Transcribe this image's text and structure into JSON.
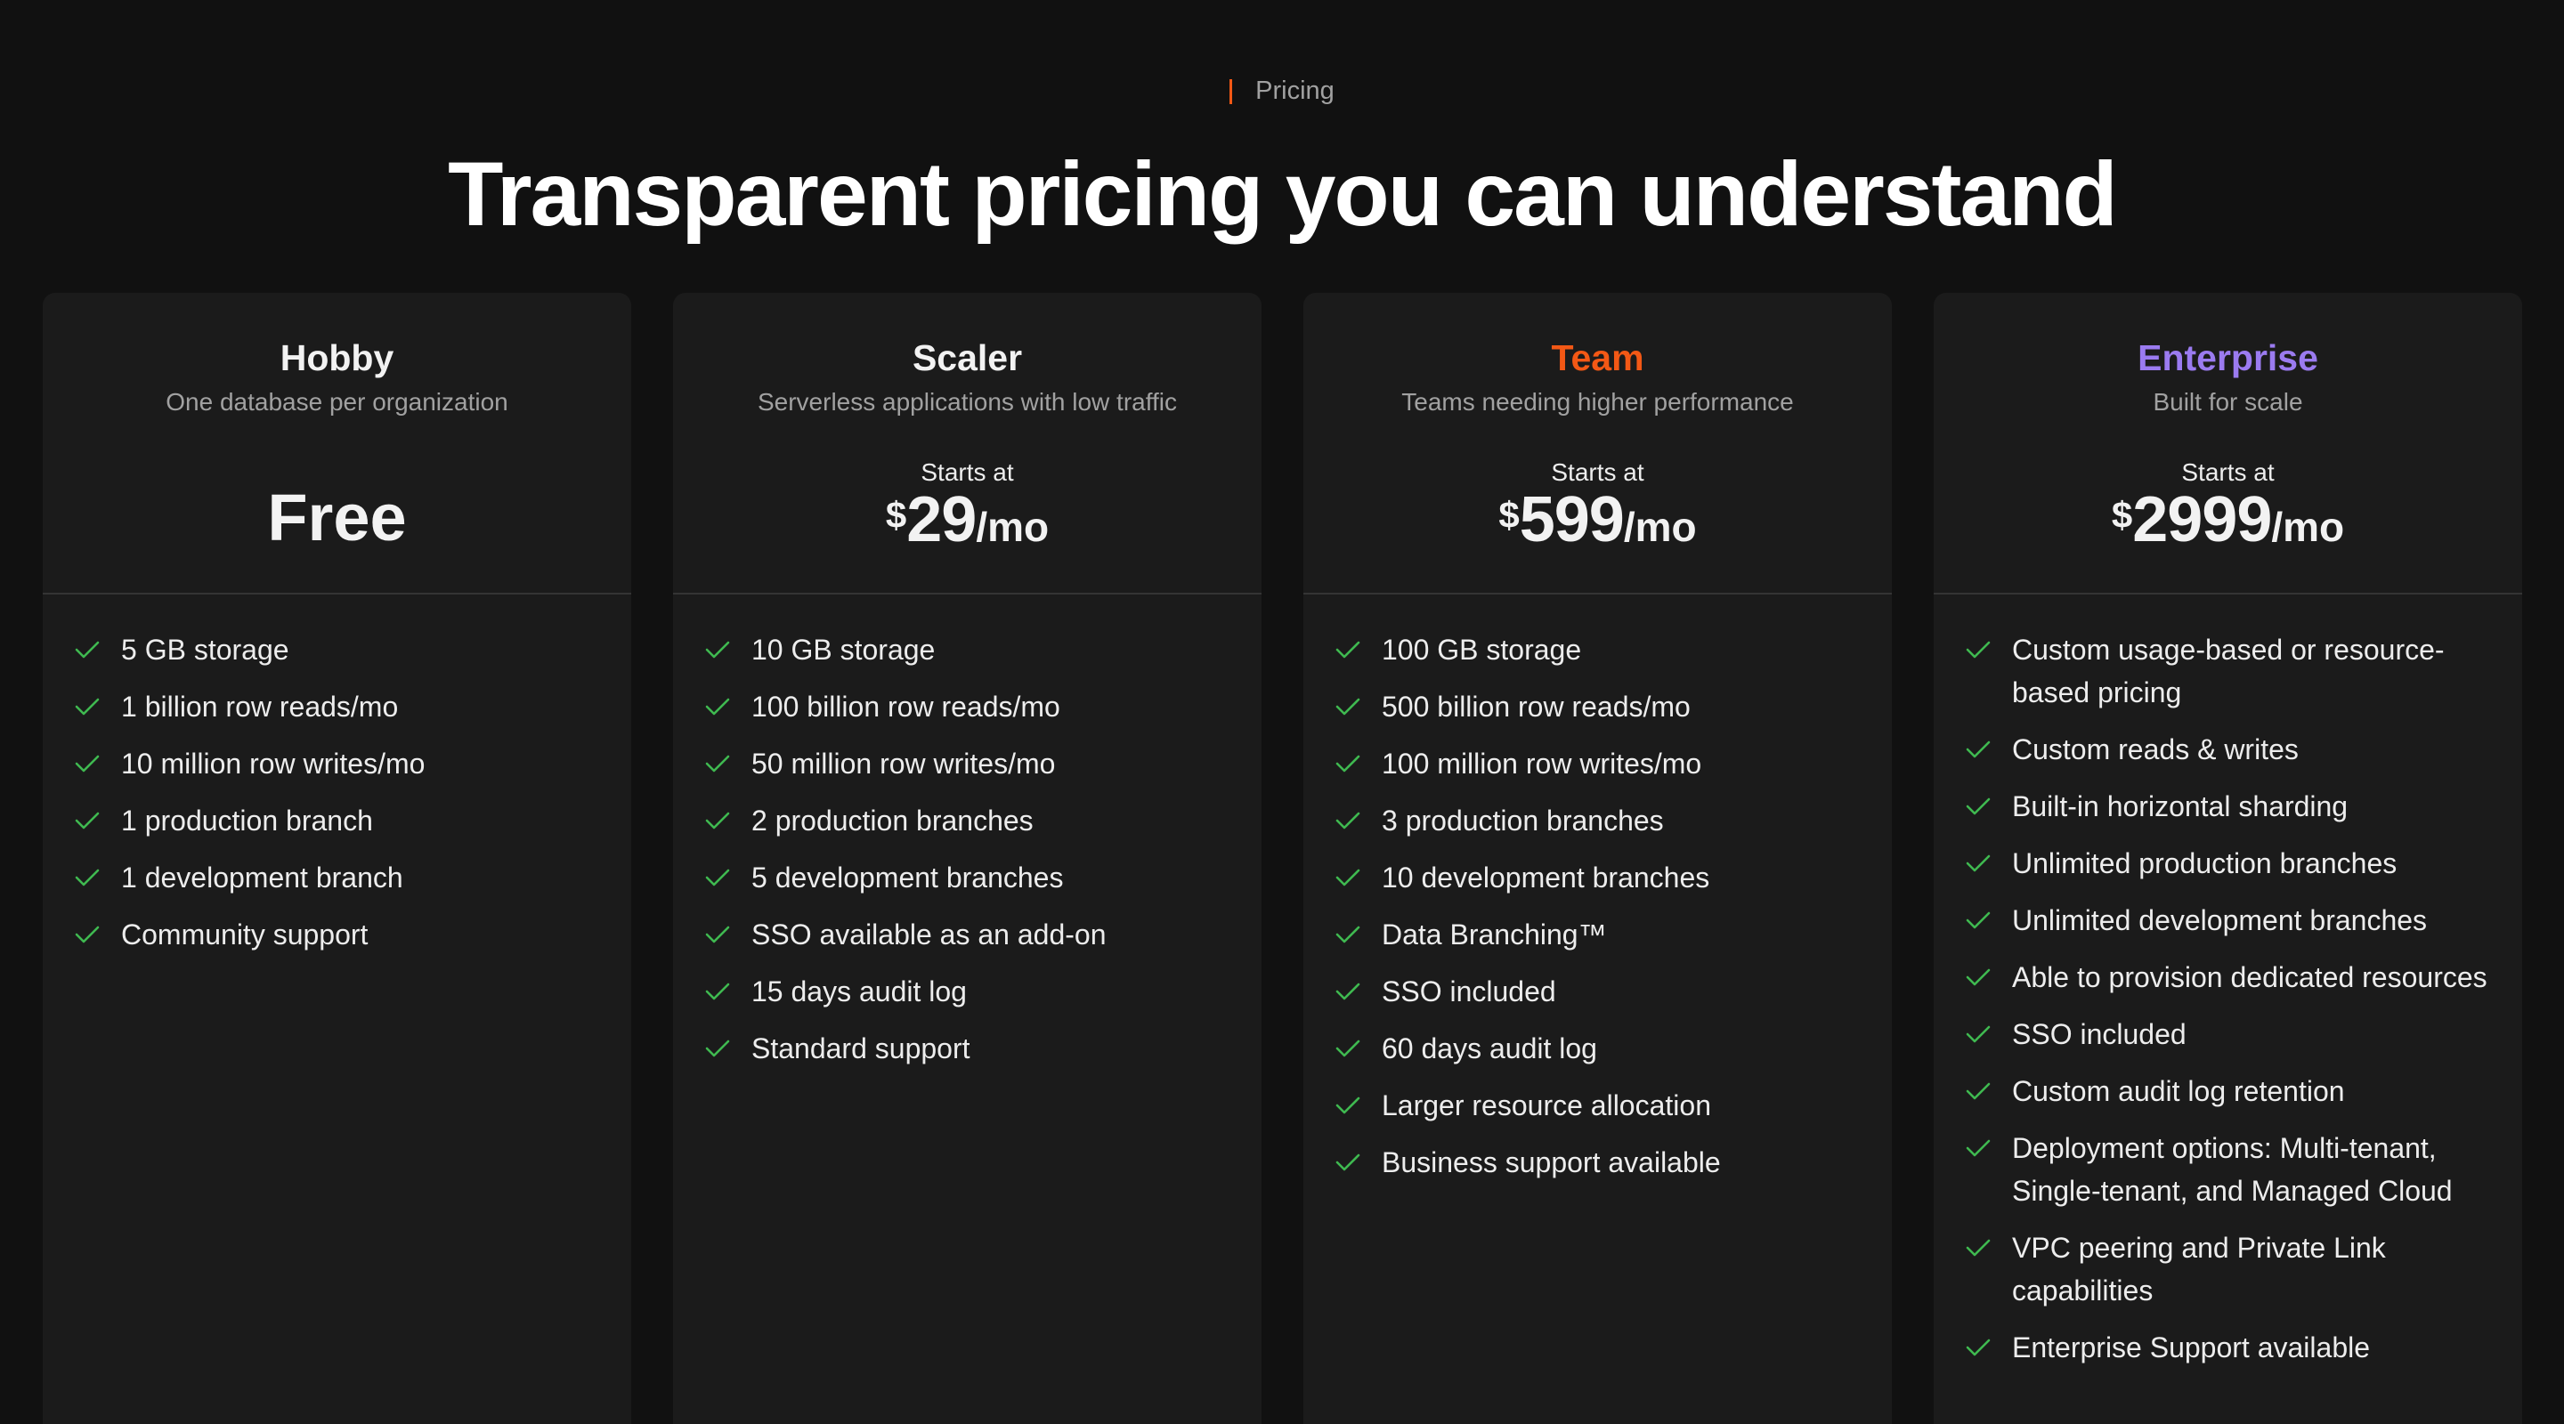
{
  "eyebrow": "Pricing",
  "headline": "Transparent pricing you can understand",
  "colors": {
    "background": "#111111",
    "card": "#1b1b1b",
    "accent_orange": "#f35815",
    "accent_purple": "#9b7bf0",
    "check_green": "#3fb950"
  },
  "plans": [
    {
      "name": "Hobby",
      "name_color": "#f2f2f2",
      "description": "One database per organization",
      "price_label": "Free",
      "features": [
        "5 GB storage",
        "1 billion row reads/mo",
        "10 million row writes/mo",
        "1 production branch",
        "1 development branch",
        "Community support"
      ]
    },
    {
      "name": "Scaler",
      "name_color": "#f2f2f2",
      "description": "Serverless applications with low traffic",
      "starts_at": "Starts at",
      "currency": "$",
      "amount": "29",
      "period": "/mo",
      "features": [
        "10 GB storage",
        "100 billion row reads/mo",
        "50 million row writes/mo",
        "2 production branches",
        "5 development branches",
        "SSO available as an add-on",
        "15 days audit log",
        "Standard support"
      ]
    },
    {
      "name": "Team",
      "name_color": "#f35815",
      "description": "Teams needing higher performance",
      "starts_at": "Starts at",
      "currency": "$",
      "amount": "599",
      "period": "/mo",
      "features": [
        "100 GB storage",
        "500 billion row reads/mo",
        "100 million row writes/mo",
        "3 production branches",
        "10 development branches",
        "Data Branching™",
        "SSO included",
        "60 days audit log",
        "Larger resource allocation",
        "Business support available"
      ]
    },
    {
      "name": "Enterprise",
      "name_color": "#9b7bf0",
      "description": "Built for scale",
      "starts_at": "Starts at",
      "currency": "$",
      "amount": "2999",
      "period": "/mo",
      "features": [
        "Custom usage-based or resource-based pricing",
        "Custom reads & writes",
        "Built-in horizontal sharding",
        "Unlimited production branches",
        "Unlimited development branches",
        "Able to provision dedicated resources",
        "SSO included",
        "Custom audit log retention",
        "Deployment options: Multi-tenant, Single-tenant, and Managed Cloud",
        "VPC peering and Private Link capabilities",
        "Enterprise Support available"
      ]
    }
  ]
}
